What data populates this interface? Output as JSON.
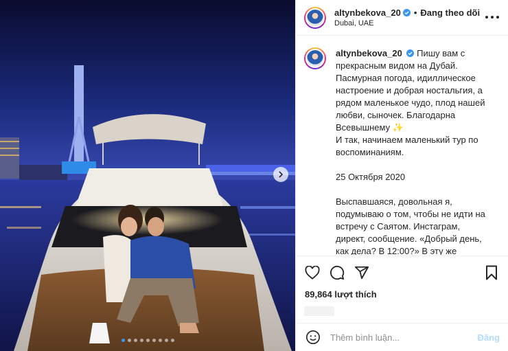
{
  "post": {
    "carousel": {
      "total_slides": 9,
      "active_slide": 1
    }
  },
  "header": {
    "username": "altynbekova_20",
    "separator": "•",
    "follow_status": "Đang theo dõi",
    "location": "Dubai, UAE"
  },
  "caption": {
    "username": "altynbekova_20",
    "paragraphs": [
      "Пишу вам с прекрасным видом на Дубай. Пасмурная погода, идиллическое настроение и добрая ностальгия, а рядом маленькое чудо, плод нашей любви, сыночек. Благодарна Всевышнему ✨",
      "И так, начинаем маленький тур по воспоминаниям.",
      "",
      "25 Октября 2020",
      "",
      "Выспавшаяся, довольная я, подумываю о том, чтобы не идти на встречу с Саятом. Инстаграм, директ, сообщение. «Добрый день, как дела? В 12:00?» В эту же минуту передумываю, отвечаю : «Добрый, в 14:30?» Саят как истинный джентельмен, без вопросов"
    ]
  },
  "actions": {
    "likes_text": "89,864 lượt thích"
  },
  "comment": {
    "placeholder": "Thêm bình luận...",
    "post_label": "Đăng"
  },
  "colors": {
    "verified_blue": "#3897f0",
    "post_button_disabled": "#b3dbff",
    "border": "#efefef"
  },
  "icons": {
    "like": "heart-icon",
    "comment": "comment-icon",
    "share": "send-icon",
    "save": "bookmark-icon",
    "more": "more-horizontal-icon",
    "emoji": "emoji-icon",
    "verified": "verified-badge-icon",
    "next": "chevron-right-icon"
  }
}
